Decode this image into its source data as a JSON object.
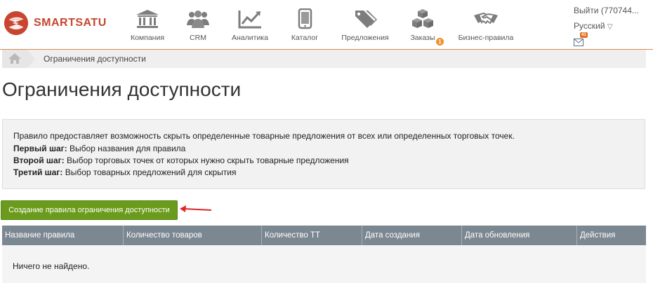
{
  "brand": {
    "name": "SMARTSATU"
  },
  "nav": [
    {
      "label": "Компания",
      "icon": "bank-icon"
    },
    {
      "label": "CRM",
      "icon": "users-icon"
    },
    {
      "label": "Аналитика",
      "icon": "chart-icon"
    },
    {
      "label": "Каталог",
      "icon": "tablet-icon"
    },
    {
      "label": "Предложения",
      "icon": "tags-icon"
    },
    {
      "label": "Заказы",
      "icon": "boxes-icon",
      "badge": "1"
    },
    {
      "label": "Бизнес-правила",
      "icon": "handshake-icon"
    }
  ],
  "user": {
    "logout_label": "Выйти (770744...",
    "language": "Русский",
    "language_caret": "▽",
    "mail_badge": "41"
  },
  "breadcrumb": {
    "current": "Ограничения доступности"
  },
  "page": {
    "title": "Ограничения доступности"
  },
  "info": {
    "intro": "Правило предоставляет возможность скрыть определенные товарные предложения от всех или определенных торговых точек.",
    "steps": [
      {
        "label": "Первый шаг:",
        "text": " Выбор названия для правила"
      },
      {
        "label": "Второй шаг:",
        "text": " Выбор торговых точек от которых нужно скрыть товарные предложения"
      },
      {
        "label": "Третий шаг:",
        "text": " Выбор товарных предложений для скрытия"
      }
    ]
  },
  "actions": {
    "create_label": "Создание правила ограничения доступности"
  },
  "table": {
    "columns": [
      "Название правила",
      "Количество товаров",
      "Количество ТТ",
      "Дата создания",
      "Дата обновления",
      "Действия"
    ],
    "empty_text": "Ничего не найдено."
  },
  "colors": {
    "brand_red": "#c8452f",
    "button_green": "#6b9b1c",
    "header_gray": "#7b8791",
    "badge_orange": "#f0902a"
  }
}
